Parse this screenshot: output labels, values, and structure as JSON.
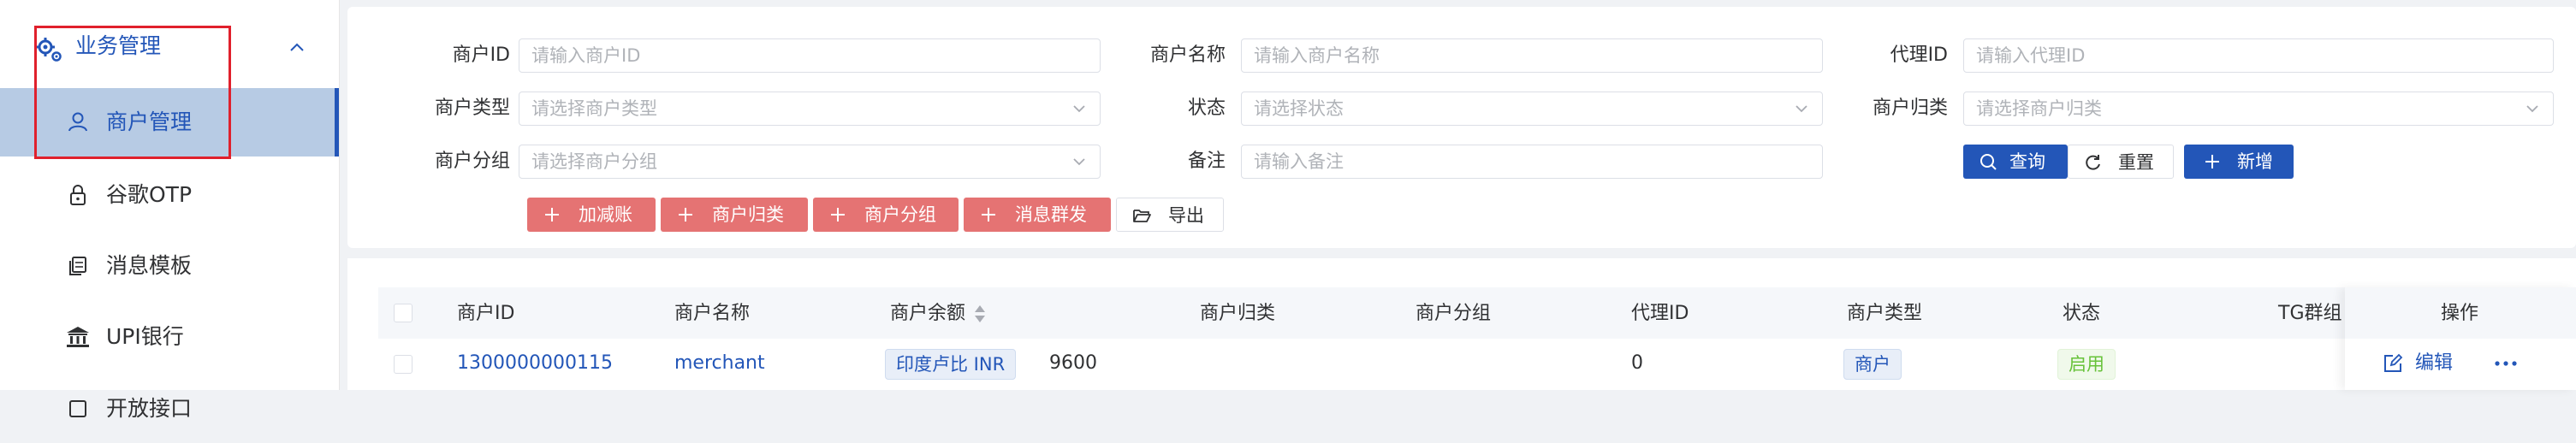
{
  "sidebar": {
    "group_label": "业务管理",
    "items": [
      {
        "label": "商户管理",
        "active": true
      },
      {
        "label": "谷歌OTP"
      },
      {
        "label": "消息模板"
      },
      {
        "label": "UPI银行"
      },
      {
        "label": "开放接口"
      }
    ]
  },
  "filters": {
    "merchant_id": {
      "label": "商户ID",
      "placeholder": "请输入商户ID"
    },
    "merchant_name": {
      "label": "商户名称",
      "placeholder": "请输入商户名称"
    },
    "agent_id": {
      "label": "代理ID",
      "placeholder": "请输入代理ID"
    },
    "merchant_type": {
      "label": "商户类型",
      "placeholder": "请选择商户类型"
    },
    "status": {
      "label": "状态",
      "placeholder": "请选择状态"
    },
    "merchant_category": {
      "label": "商户归类",
      "placeholder": "请选择商户归类"
    },
    "merchant_group": {
      "label": "商户分组",
      "placeholder": "请选择商户分组"
    },
    "remark": {
      "label": "备注",
      "placeholder": "请输入备注"
    }
  },
  "actions": {
    "adjust": "加减账",
    "categorize": "商户归类",
    "group": "商户分组",
    "broadcast": "消息群发",
    "export": "导出",
    "query": "查询",
    "reset": "重置",
    "add": "新增"
  },
  "table": {
    "columns": [
      "商户ID",
      "商户名称",
      "商户余额",
      "商户归类",
      "商户分组",
      "代理ID",
      "商户类型",
      "状态",
      "TG群组",
      "操作"
    ],
    "rows": [
      {
        "merchant_id": "1300000000115",
        "merchant_name": "merchant",
        "currency_tag": "印度卢比 INR",
        "balance": "9600",
        "category": "",
        "group": "",
        "agent_id": "0",
        "type": "商户",
        "status": "启用",
        "tg_group": "",
        "edit_label": "编辑"
      }
    ]
  },
  "colors": {
    "primary": "#2356b8",
    "danger_button": "#e57373",
    "active_menu_bg": "#b7cbe4",
    "success": "#67c23a",
    "highlight_box": "#e0202c"
  }
}
